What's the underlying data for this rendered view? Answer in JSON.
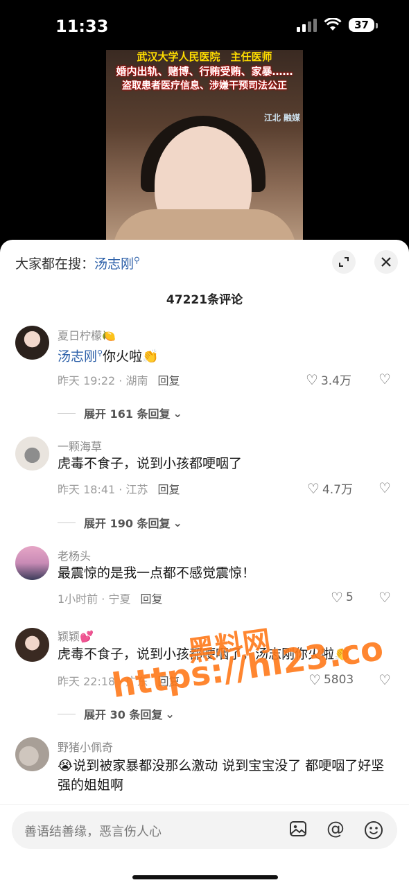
{
  "status": {
    "time": "11:33",
    "battery": "37"
  },
  "video": {
    "caption_line1": "武汉大学人民医院　主任医师",
    "caption_line2": "婚内出轨、赌博、行贿受贿、家暴……",
    "caption_line3": "盗取患者医疗信息、涉嫌干预司法公正",
    "side_watermark": "江北 融媒"
  },
  "panel": {
    "search_prefix": "大家都在搜：",
    "search_term": "汤志刚",
    "comment_count": "47221条评论"
  },
  "comments": [
    {
      "name": "夏日柠檬🍋",
      "mention": "汤志刚",
      "text": "你火啦👏",
      "meta": "昨天 19:22 · 湖南",
      "reply": "回复",
      "likes": "3.4万",
      "expand": "展开 161 条回复"
    },
    {
      "name": "一颗海草",
      "text": "虎毒不食子，说到小孩都哽咽了",
      "meta": "昨天 18:41 · 江苏",
      "reply": "回复",
      "likes": "4.7万",
      "expand": "展开 190 条回复"
    },
    {
      "name": "老杨头",
      "text": "最震惊的是我一点都不感觉震惊！",
      "meta": "1小时前 · 宁夏",
      "reply": "回复",
      "likes": "5"
    },
    {
      "name": "颖颖💕",
      "text": "虎毒不食子，说到小孩都哽咽了，汤志刚你火啦👏",
      "meta": "昨天 22:18 · 广东",
      "reply": "回复",
      "likes": "5803",
      "expand": "展开 30 条回复"
    },
    {
      "name": "野猪小佩奇",
      "text": "😭说到被家暴都没那么激动 说到宝宝没了 都哽咽了好坚强的姐姐啊"
    }
  ],
  "input": {
    "placeholder": "善语结善缘，恶言伤人心"
  },
  "watermark": {
    "line1": "黑料网",
    "line2": "https://hl23.co"
  }
}
